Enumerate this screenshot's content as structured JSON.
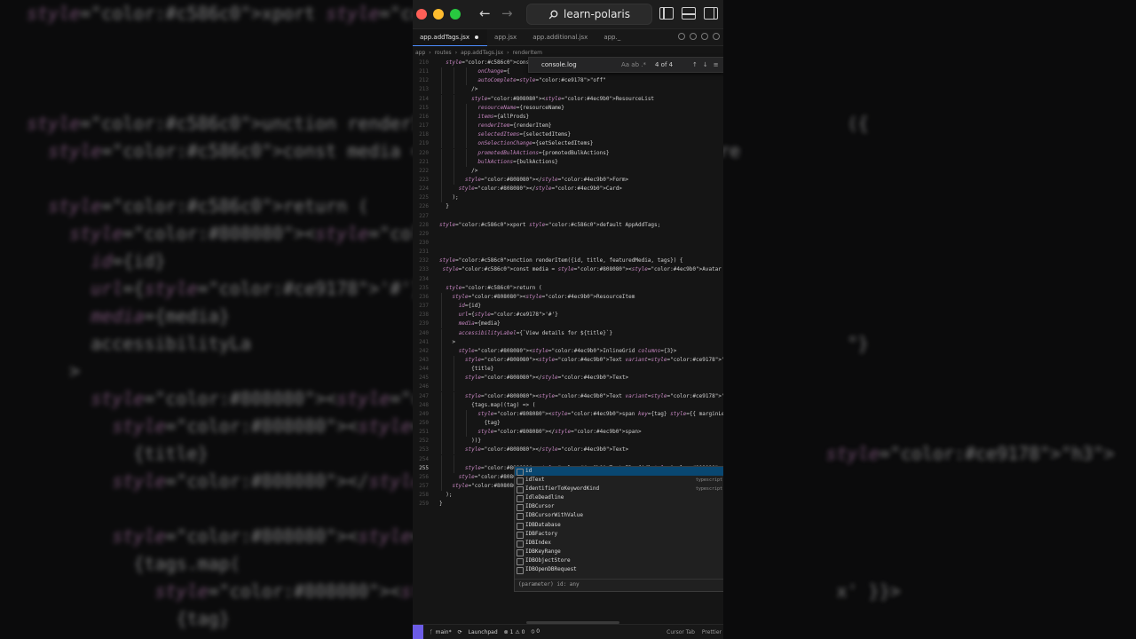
{
  "background": {
    "left_lines": [
      {
        "n": "228",
        "t": "xport default AppAddTags;"
      },
      {
        "n": "229",
        "t": ""
      },
      {
        "n": "230",
        "t": ""
      },
      {
        "n": "231",
        "t": ""
      },
      {
        "n": "232",
        "t": "unction renderItem({"
      },
      {
        "n": "233",
        "t": "  const media = <Avat"
      },
      {
        "n": "234",
        "t": ""
      },
      {
        "n": "235",
        "t": "  return ("
      },
      {
        "n": "236",
        "t": "    <ResourceItem"
      },
      {
        "n": "237",
        "t": "      id={id}"
      },
      {
        "n": "238",
        "t": "      url={'#'}"
      },
      {
        "n": "239",
        "t": "      media={media}"
      },
      {
        "n": "240",
        "t": "      accessibilityLa"
      },
      {
        "n": "241",
        "t": "    >"
      },
      {
        "n": "242",
        "t": "      <InlineGrid col"
      },
      {
        "n": "243",
        "t": "        <Text variant"
      },
      {
        "n": "244",
        "t": "          {title}"
      },
      {
        "n": "245",
        "t": "        </Text>"
      },
      {
        "n": "246",
        "t": ""
      },
      {
        "n": "247",
        "t": "        <Text variant"
      },
      {
        "n": "248",
        "t": "          {tags.map("
      },
      {
        "n": "249",
        "t": "            <span key"
      },
      {
        "n": "250",
        "t": "              {tag}"
      }
    ],
    "right_lines": [
      "",
      "",
      "",
      "",
      "                                       ({",
      "   me={title} source={feature",
      "",
      "",
      "",
      "",
      "",
      "",
      "                                       \"}",
      "",
      "",
      "",
      "                                     \"h3\">",
      "",
      "",
      "",
      "",
      "                                      x' }}>",
      ""
    ]
  },
  "window": {
    "title": "learn-polaris",
    "tabs": [
      {
        "label": "app.addTags.jsx",
        "active": true,
        "modified": true
      },
      {
        "label": "app.jsx",
        "active": false,
        "modified": false
      },
      {
        "label": "app.additional.jsx",
        "active": false,
        "modified": false
      },
      {
        "label": "app._",
        "active": false,
        "modified": false
      }
    ],
    "breadcrumb": [
      "app",
      "routes",
      "app.addTags.jsx",
      "renderItem"
    ],
    "find": {
      "query": "console.log",
      "options": "Aa ab .*",
      "count": "4 of 4",
      "nav": "↑↓≡"
    }
  },
  "editor": {
    "lines": [
      {
        "n": "210",
        "t": "  const AppAddTags = () => ",
        "d": 0
      },
      {
        "n": "211",
        "t": "            onChange={",
        "d": 3
      },
      {
        "n": "212",
        "t": "            autoComplete=\"off\"",
        "d": 3
      },
      {
        "n": "213",
        "t": "          />",
        "d": 2
      },
      {
        "n": "214",
        "t": "          <ResourceList",
        "d": 2
      },
      {
        "n": "215",
        "t": "            resourceName={resourceName}",
        "d": 3
      },
      {
        "n": "216",
        "t": "            items={allProds}",
        "d": 3
      },
      {
        "n": "217",
        "t": "            renderItem={renderItem}",
        "d": 3
      },
      {
        "n": "218",
        "t": "            selectedItems={selectedItems}",
        "d": 3
      },
      {
        "n": "219",
        "t": "            onSelectionChange={setSelectedItems}",
        "d": 3
      },
      {
        "n": "220",
        "t": "            promotedBulkActions={promotedBulkActions}",
        "d": 3
      },
      {
        "n": "221",
        "t": "            bulkActions={bulkActions}",
        "d": 3
      },
      {
        "n": "222",
        "t": "          />",
        "d": 2
      },
      {
        "n": "223",
        "t": "        </Form>",
        "d": 2
      },
      {
        "n": "224",
        "t": "      </Card>",
        "d": 1
      },
      {
        "n": "225",
        "t": "    );",
        "d": 1
      },
      {
        "n": "226",
        "t": "  }",
        "d": 0
      },
      {
        "n": "227",
        "t": "",
        "d": 0
      },
      {
        "n": "228",
        "t": "xport default AppAddTags;",
        "d": 0
      },
      {
        "n": "229",
        "t": "",
        "d": 0
      },
      {
        "n": "230",
        "t": "",
        "d": 0
      },
      {
        "n": "231",
        "t": "",
        "d": 0
      },
      {
        "n": "232",
        "t": "unction renderItem({id, title, featuredMedia, tags}) {",
        "d": 0
      },
      {
        "n": "233",
        "t": " const media = <Avatar customer={false} size=\"md\" name={title} source={featured",
        "d": 0
      },
      {
        "n": "234",
        "t": "",
        "d": 0
      },
      {
        "n": "235",
        "t": "  return (",
        "d": 0
      },
      {
        "n": "236",
        "t": "    <ResourceItem",
        "d": 1
      },
      {
        "n": "237",
        "t": "      id={id}",
        "d": 1
      },
      {
        "n": "238",
        "t": "      url={'#'}",
        "d": 1
      },
      {
        "n": "239",
        "t": "      media={media}",
        "d": 1
      },
      {
        "n": "240",
        "t": "      accessibilityLabel={`View details for ${title}`}",
        "d": 1
      },
      {
        "n": "241",
        "t": "    >",
        "d": 1
      },
      {
        "n": "242",
        "t": "      <InlineGrid columns={3}>",
        "d": 1
      },
      {
        "n": "243",
        "t": "        <Text variant=\"bodyMd\" fontWeight=\"bold\" as=\"h3\">",
        "d": 2
      },
      {
        "n": "244",
        "t": "          {title}",
        "d": 2
      },
      {
        "n": "245",
        "t": "        </Text>",
        "d": 2
      },
      {
        "n": "246",
        "t": "",
        "d": 2
      },
      {
        "n": "247",
        "t": "        <Text variant=\"bodyMd\">",
        "d": 2
      },
      {
        "n": "248",
        "t": "          {tags.map((tag) => (",
        "d": 2
      },
      {
        "n": "249",
        "t": "            <span key={tag} style={{ marginLeft: '8px' }}>",
        "d": 3
      },
      {
        "n": "250",
        "t": "              {tag}",
        "d": 3
      },
      {
        "n": "251",
        "t": "            </span>",
        "d": 3
      },
      {
        "n": "252",
        "t": "          ))}",
        "d": 2
      },
      {
        "n": "253",
        "t": "        </Text>",
        "d": 2
      },
      {
        "n": "254",
        "t": "",
        "d": 2
      },
      {
        "n": "255",
        "t": "        <Text>ID: {id}</Text>",
        "d": 2,
        "current": true
      },
      {
        "n": "256",
        "t": "      </InlineGrid>",
        "d": 1
      },
      {
        "n": "257",
        "t": "    </ResourceItem>",
        "d": 1
      },
      {
        "n": "258",
        "t": "  );",
        "d": 0
      },
      {
        "n": "259",
        "t": "}",
        "d": 0
      }
    ]
  },
  "suggest": {
    "items": [
      {
        "label": "id",
        "type": "",
        "selected": true
      },
      {
        "label": "idText",
        "type": "typescript",
        "selected": false
      },
      {
        "label": "IdentifierToKeywordKind",
        "type": "typescript",
        "selected": false
      },
      {
        "label": "IdleDeadline",
        "type": "",
        "selected": false
      },
      {
        "label": "IDBCursor",
        "type": "",
        "selected": false
      },
      {
        "label": "IDBCursorWithValue",
        "type": "",
        "selected": false
      },
      {
        "label": "IDBDatabase",
        "type": "",
        "selected": false
      },
      {
        "label": "IDBFactory",
        "type": "",
        "selected": false
      },
      {
        "label": "IDBIndex",
        "type": "",
        "selected": false
      },
      {
        "label": "IDBKeyRange",
        "type": "",
        "selected": false
      },
      {
        "label": "IDBObjectStore",
        "type": "",
        "selected": false
      },
      {
        "label": "IDBOpenDBRequest",
        "type": "",
        "selected": false
      }
    ],
    "detail": "(parameter) id: any"
  },
  "statusbar": {
    "branch": "main*",
    "sync": "⟳",
    "launchpad": "Launchpad",
    "errors": "⊗ 1 ⚠ 0",
    "ports": "⦸ 0",
    "cursor_tab": "Cursor Tab",
    "prettier": "Prettier"
  },
  "colors": {
    "keyword": "#c586c0",
    "component": "#4ec9b0",
    "attr": "#c586c0",
    "string": "#ce9178",
    "brace": "#ffd700",
    "plain": "#cfcfcf",
    "accent": "#4c8dff"
  }
}
